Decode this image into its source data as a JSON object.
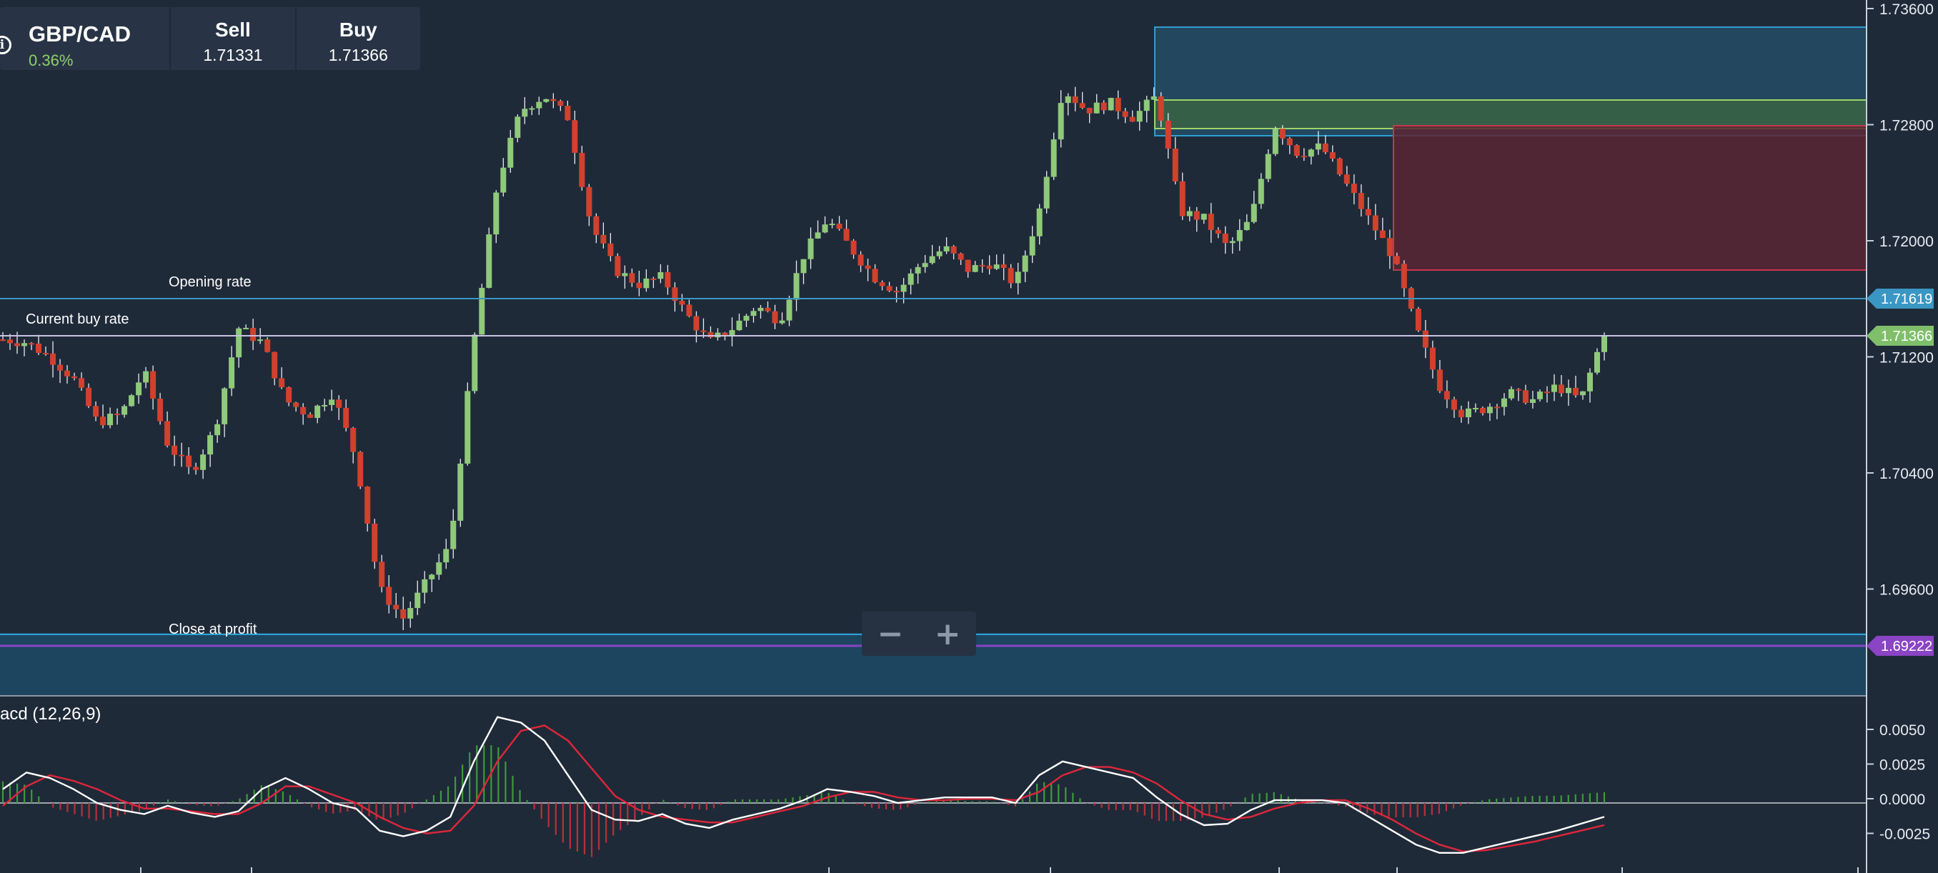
{
  "instrument": {
    "symbol": "GBP/CAD",
    "change": "0.36%",
    "info_glyph": "i",
    "sell_label": "Sell",
    "sell_value": "1.71331",
    "buy_label": "Buy",
    "buy_value": "1.71366"
  },
  "lines": {
    "opening_label": "Opening rate",
    "opening_value": "1.71619",
    "current_label": "Current buy rate",
    "current_value": "1.71366",
    "close_label": "Close at profit",
    "close_value": "1.69222"
  },
  "zoom": {
    "minus": "−",
    "plus": "+"
  },
  "macd": {
    "title": "acd (12,26,9)"
  },
  "colors": {
    "background": "#1f2a38",
    "bull": "#8fc97a",
    "bear": "#d2402e",
    "opening_line": "#3a97c4",
    "current_line": "#c9c3e3",
    "profit_line": "#8a44c4",
    "macd_line": "#ffffff",
    "signal_line": "#e0263a"
  },
  "chart_data": [
    {
      "type": "candlestick",
      "y_ticks": [
        "1.73600",
        "1.72800",
        "1.72000",
        "1.71200",
        "1.70400",
        "1.69600"
      ],
      "ylim": [
        1.69,
        1.737
      ],
      "price_path": [
        1.7132,
        1.713,
        1.712,
        1.7105,
        1.7075,
        1.708,
        1.711,
        1.706,
        1.704,
        1.707,
        1.714,
        1.713,
        1.709,
        1.708,
        1.7095,
        1.705,
        1.696,
        1.694,
        1.6965,
        1.699,
        1.713,
        1.724,
        1.729,
        1.73,
        1.7285,
        1.721,
        1.718,
        1.717,
        1.7175,
        1.715,
        1.713,
        1.714,
        1.7155,
        1.7145,
        1.719,
        1.7215,
        1.7195,
        1.7175,
        1.7165,
        1.7185,
        1.7195,
        1.718,
        1.7185,
        1.717,
        1.722,
        1.7305,
        1.729,
        1.7295,
        1.7285,
        1.73,
        1.722,
        1.7215,
        1.7195,
        1.7215,
        1.728,
        1.726,
        1.7265,
        1.724,
        1.7215,
        1.719,
        1.714,
        1.71,
        1.708,
        1.7085,
        1.7095,
        1.709,
        1.71,
        1.709,
        1.7137
      ]
    },
    {
      "type": "line",
      "title": "acd (12,26,9)",
      "y_ticks": [
        "0.0050",
        "0.0025",
        "0.0000",
        "-0.0025"
      ],
      "ylim": [
        -0.0045,
        0.0068
      ],
      "macd": [
        0.001,
        0.0022,
        0.0018,
        0.001,
        0.0,
        -0.0005,
        -0.0008,
        -0.0002,
        -0.0007,
        -0.001,
        -0.0006,
        0.001,
        0.0018,
        0.001,
        0.0,
        -0.0004,
        -0.002,
        -0.0024,
        -0.002,
        -0.001,
        0.003,
        0.0062,
        0.0058,
        0.0045,
        0.002,
        -0.0005,
        -0.0012,
        -0.0013,
        -0.0008,
        -0.0015,
        -0.0018,
        -0.0012,
        -0.0008,
        -0.0004,
        0.0002,
        0.001,
        0.0008,
        0.0005,
        0.0,
        0.0002,
        0.0004,
        0.0004,
        0.0004,
        0.0,
        0.002,
        0.003,
        0.0026,
        0.0022,
        0.0018,
        0.0004,
        -0.0008,
        -0.0016,
        -0.0015,
        -0.0005,
        0.0002,
        0.0002,
        0.0002,
        0.0,
        -0.001,
        -0.002,
        -0.003,
        -0.0036,
        -0.0036,
        -0.0032,
        -0.0028,
        -0.0024,
        -0.002,
        -0.0015,
        -0.001
      ],
      "signal": [
        -0.0002,
        0.0012,
        0.002,
        0.0016,
        0.001,
        0.0002,
        -0.0004,
        -0.0004,
        -0.0006,
        -0.0008,
        -0.0008,
        0.0,
        0.0012,
        0.0012,
        0.0006,
        0.0,
        -0.001,
        -0.0018,
        -0.0022,
        -0.002,
        -0.0002,
        0.003,
        0.0052,
        0.0056,
        0.0045,
        0.0025,
        0.0005,
        -0.0005,
        -0.001,
        -0.0012,
        -0.0014,
        -0.0014,
        -0.001,
        -0.0006,
        -0.0002,
        0.0004,
        0.0008,
        0.0008,
        0.0004,
        0.0002,
        0.0002,
        0.0003,
        0.0003,
        0.0002,
        0.0008,
        0.002,
        0.0026,
        0.0026,
        0.0022,
        0.0014,
        0.0002,
        -0.0008,
        -0.0012,
        -0.001,
        -0.0004,
        0.0,
        0.0002,
        0.0002,
        -0.0004,
        -0.0012,
        -0.0022,
        -0.003,
        -0.0035,
        -0.0034,
        -0.0031,
        -0.0028,
        -0.0024,
        -0.002,
        -0.0016
      ]
    }
  ]
}
